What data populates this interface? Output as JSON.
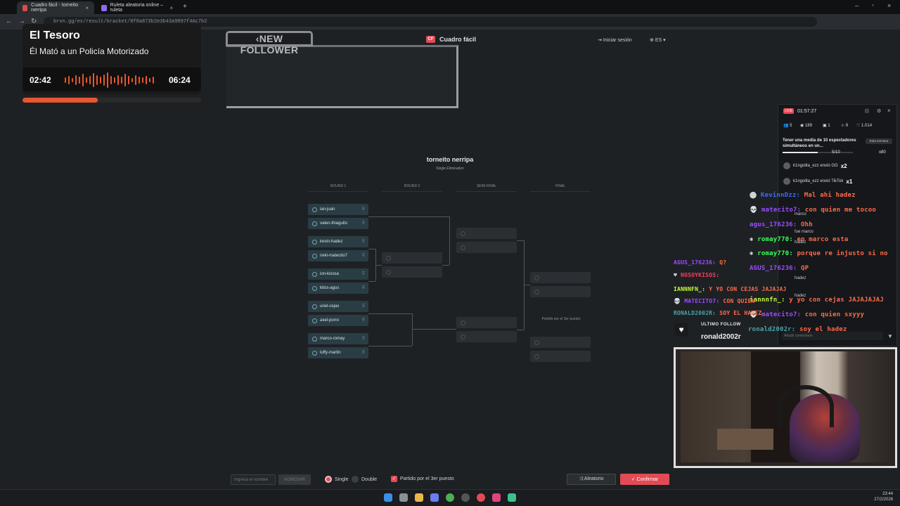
{
  "browser": {
    "tabs": [
      {
        "label": "Cuadro fácil - torneito nerripa",
        "active": true
      },
      {
        "label": "Ruleta aleatoria online – ruleta",
        "active": false
      }
    ],
    "url": "brvn.gg/es/result/bracket/8f8a873b2e3b43a9897f4Ac7b2"
  },
  "header": {
    "logo_text": "Cuadro fácil",
    "logo_mark": "CF",
    "login_label": "Iniciar sesión",
    "lang_label": "ES"
  },
  "tournament": {
    "title": "torneito nerripa",
    "subtitle": "Single Elimination",
    "rounds": [
      "ROUND 1",
      "ROUND 2",
      "SEMI-FINAL",
      "FINAL"
    ],
    "round1": [
      "ian-juan",
      "valen-thiaguito",
      "kevin-hadez",
      "neki-matecito7",
      "ion-kisosa",
      "kitos-agus",
      "uriel-cejas",
      "axel-porro",
      "marco-romay",
      "luffy-martin"
    ],
    "third_place_label": "Partido por el 3er puesto"
  },
  "controls": {
    "name_placeholder": "Ingresa el nombre",
    "add_label": "AGREGAR",
    "single_label": "Single",
    "double_label": "Double",
    "third_place_label": "Partido por el 3er puesto",
    "random_label": "Aleatorio",
    "confirm_label": "Confirmar"
  },
  "music": {
    "title": "El Tesoro",
    "artist": "Él Mató a un Policía Motorizado",
    "elapsed": "02:42",
    "total": "06:24",
    "progress": 0.42,
    "accent": "#e8572d"
  },
  "alert": {
    "label": "NEW FOLLOWER"
  },
  "stream": {
    "live_badge": "LIVE",
    "uptime": "01:57:27",
    "stats": [
      "5",
      "189",
      "1",
      "9",
      "1.014"
    ],
    "goal_text": "Tener una media de 10 espectadores simultáneos en un...",
    "goal_period": "Esta semana",
    "goal_count": "5/10",
    "goal_fraction": 0.5,
    "goal_multiplier": "x80",
    "gifts": [
      {
        "text": "k1ngolita_ezz envió GG",
        "mult": "x2"
      },
      {
        "text": "k1ngolita_ezz envió TikTok",
        "mult": "x1"
      }
    ],
    "comment_placeholder": "Añadir comentario"
  },
  "chat": [
    {
      "name": "KevinnDzz:",
      "msg": "Mal ahi hadez",
      "color": "#3a6cff"
    },
    {
      "name": "matecito7:",
      "msg": "con quien me tocoo",
      "color": "#9b4dff"
    },
    {
      "name": "agus_176236:",
      "msg": "Ohh",
      "color": "#9b4dff"
    },
    {
      "name": "romay770:",
      "msg": "en marco esta",
      "color": "#3dff5a"
    },
    {
      "name": "romay770:",
      "msg": "porque re injusto si no",
      "color": "#3dff5a"
    },
    {
      "name": "AGUS_176236:",
      "msg": "QP",
      "color": "#9b4dff"
    },
    {
      "name": "AGUS_176236:",
      "msg": "Q?",
      "color": "#9b4dff"
    },
    {
      "name": "NOSOYKISOS:",
      "msg": "",
      "color": "#ff3a5a"
    },
    {
      "name": "IANNNFN_:",
      "msg": "Y YO CON CEJAS JAJAJAJ",
      "color": "#c8ff3a"
    },
    {
      "name": "MATECITO7:",
      "msg": "CON QUIEN",
      "color": "#9b4dff"
    },
    {
      "name": "RONALD2002R:",
      "msg": "SOY EL HADEZ",
      "color": "#4aa3a8"
    },
    {
      "name": "iannnfn_:",
      "msg": "y yo con cejas JAJAJAJAJ",
      "color": "#c8ff3a"
    },
    {
      "name": "matecito7:",
      "msg": "con quien sxyyy",
      "color": "#9b4dff"
    },
    {
      "name": "ronald2002r:",
      "msg": "soy el hadez",
      "color": "#4aa3a8"
    }
  ],
  "chat_small": [
    "marco",
    "fue marco",
    "hadez",
    "hadez",
    "hadez"
  ],
  "follow": {
    "label": "ULTIMO FOLLOW",
    "name": "ronald2002r"
  },
  "taskbar": {
    "time": "23:44",
    "date": "27/2/2026"
  }
}
